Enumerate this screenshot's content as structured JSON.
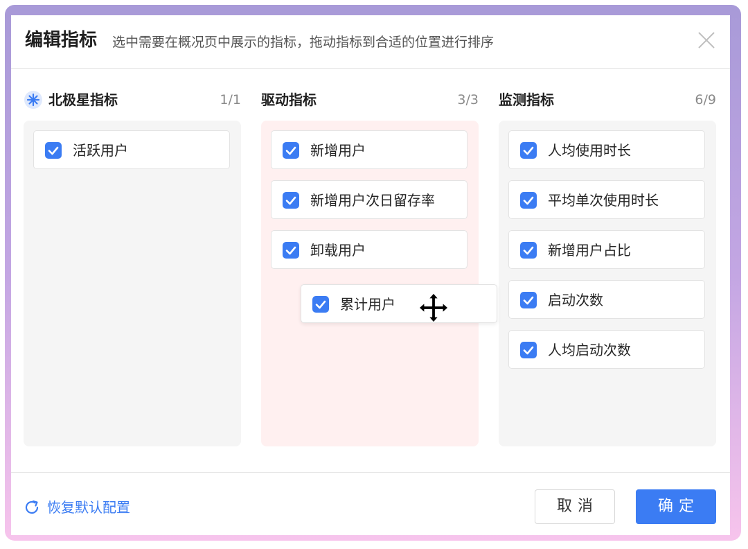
{
  "dialog": {
    "title": "编辑指标",
    "subtitle": "选中需要在概况页中展示的指标，拖动指标到合适的位置进行排序"
  },
  "columns": [
    {
      "title": "北极星指标",
      "icon": "star-icon",
      "count": "1/1",
      "items": [
        {
          "label": "活跃用户",
          "checked": true
        }
      ]
    },
    {
      "title": "驱动指标",
      "count": "3/3",
      "items": [
        {
          "label": "新增用户",
          "checked": true
        },
        {
          "label": "新增用户次日留存率",
          "checked": true
        },
        {
          "label": "卸载用户",
          "checked": true
        }
      ]
    },
    {
      "title": "监测指标",
      "count": "6/9",
      "items": [
        {
          "label": "人均使用时长",
          "checked": true
        },
        {
          "label": "平均单次使用时长",
          "checked": true
        },
        {
          "label": "新增用户占比",
          "checked": true
        },
        {
          "label": "启动次数",
          "checked": true
        },
        {
          "label": "人均启动次数",
          "checked": true
        }
      ]
    }
  ],
  "dragging_item": {
    "label": "累计用户",
    "checked": true
  },
  "footer": {
    "reset_label": "恢复默认配置",
    "cancel_label": "取消",
    "ok_label": "确定"
  },
  "colors": {
    "accent": "#3b7cf3",
    "drop_target_bg": "#fff0f0",
    "column_bg": "#f5f5f5"
  }
}
